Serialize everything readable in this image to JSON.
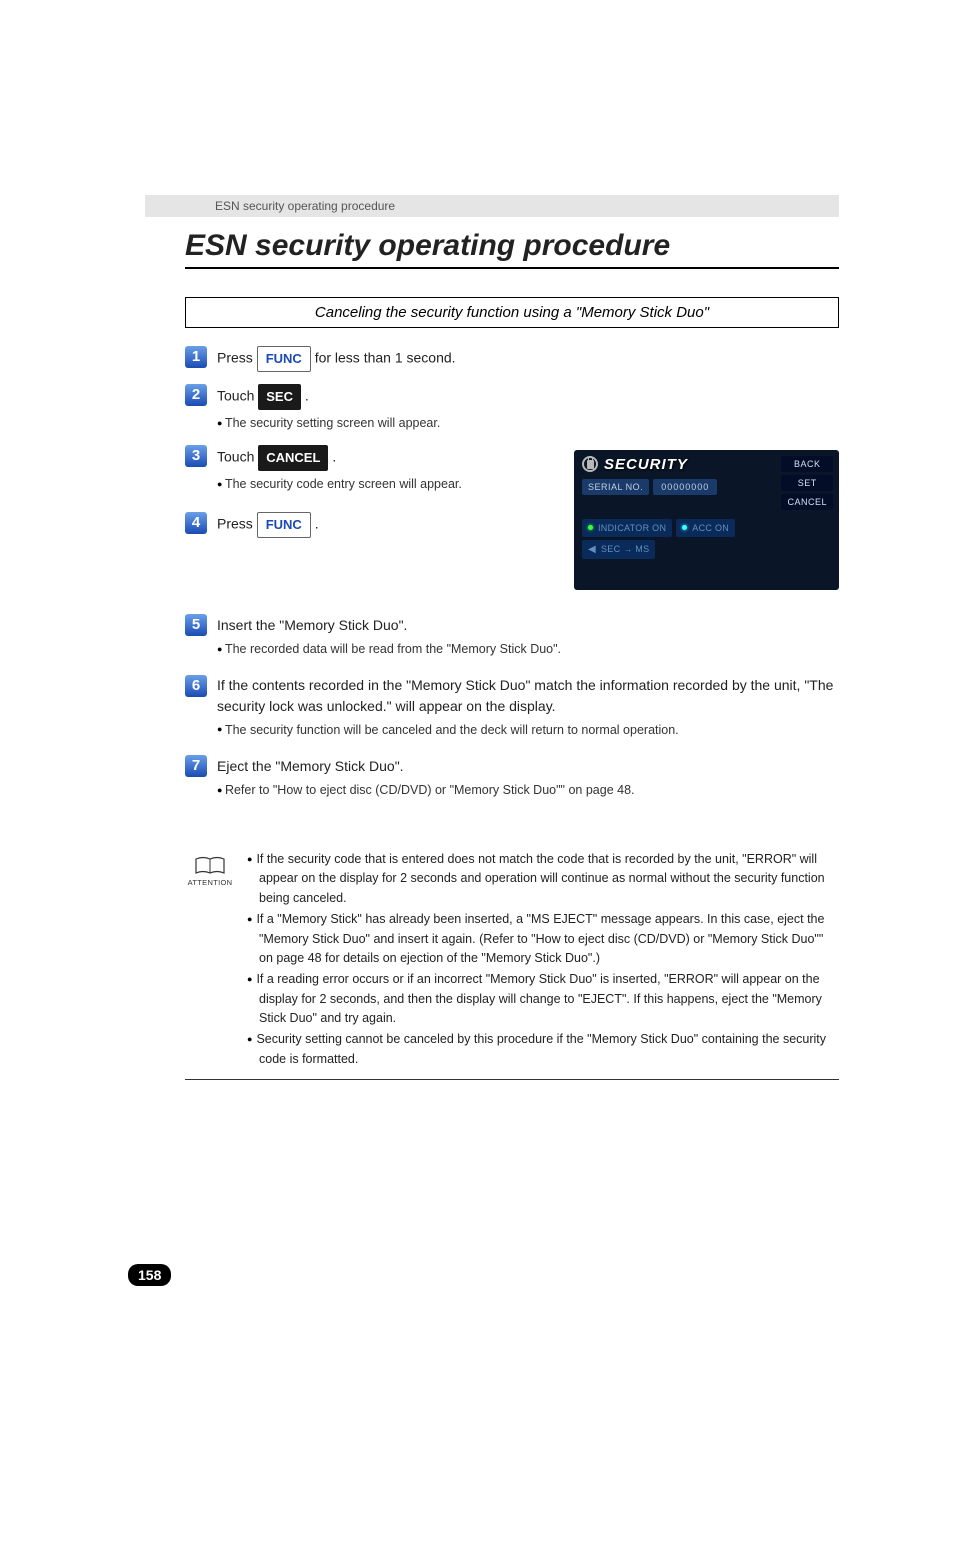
{
  "header": "ESN security operating procedure",
  "title": "ESN security operating procedure",
  "subtitle": "Canceling the security function using a \"Memory Stick Duo\"",
  "buttons": {
    "func": "FUNC",
    "sec": "SEC",
    "cancel": "CANCEL"
  },
  "steps": {
    "1": {
      "before": "Press ",
      "after": " for less than 1 second."
    },
    "2": {
      "before": "Touch ",
      "after": " .",
      "bullet": "The security setting screen will appear."
    },
    "3": {
      "before": "Touch ",
      "after": " .",
      "bullet": "The security code entry screen will appear."
    },
    "4": {
      "before": "Press ",
      "after": " ."
    },
    "5": {
      "text": "Insert the \"Memory Stick Duo\".",
      "bullet": "The recorded data will be read from the \"Memory Stick Duo\"."
    },
    "6": {
      "text": "If the contents recorded in the \"Memory Stick Duo\" match the information recorded by the unit, \"The security lock was unlocked.\" will appear on the display.",
      "bullet": "The security function will be canceled and the deck will return to normal operation."
    },
    "7": {
      "text": "Eject the \"Memory Stick Duo\".",
      "bullet": "Refer to \"How to eject disc (CD/DVD) or \"Memory Stick Duo\"\" on page 48."
    }
  },
  "screenshot": {
    "title": "SECURITY",
    "back": "BACK",
    "set": "SET",
    "cancel": "CANCEL",
    "serial_label": "SERIAL NO.",
    "serial_value": "00000000",
    "indicator": "INDICATOR  ON",
    "acc": "ACC  ON",
    "sec_ms": "SEC → MS"
  },
  "attention": {
    "label": "ATTENTION",
    "items": [
      "If the security code that is entered does not match the code that is recorded by the unit, \"ERROR\" will appear on the display for 2 seconds and operation will continue as normal without the security function being canceled.",
      "If a \"Memory Stick\" has already been inserted, a \"MS EJECT\" message appears. In this case, eject the \"Memory Stick Duo\" and insert it again. (Refer to \"How to eject disc (CD/DVD) or \"Memory Stick Duo\"\" on page 48 for details on ejection of the \"Memory Stick Duo\".)",
      "If a reading error occurs or if an incorrect \"Memory Stick Duo\" is inserted, \"ERROR\" will appear on the display for 2 seconds, and then the display will change to \"EJECT\". If this happens, eject the \"Memory Stick Duo\" and try again.",
      "Security setting cannot be canceled by this procedure if the \"Memory Stick Duo\" containing the security code is formatted."
    ]
  },
  "page_number": "158"
}
